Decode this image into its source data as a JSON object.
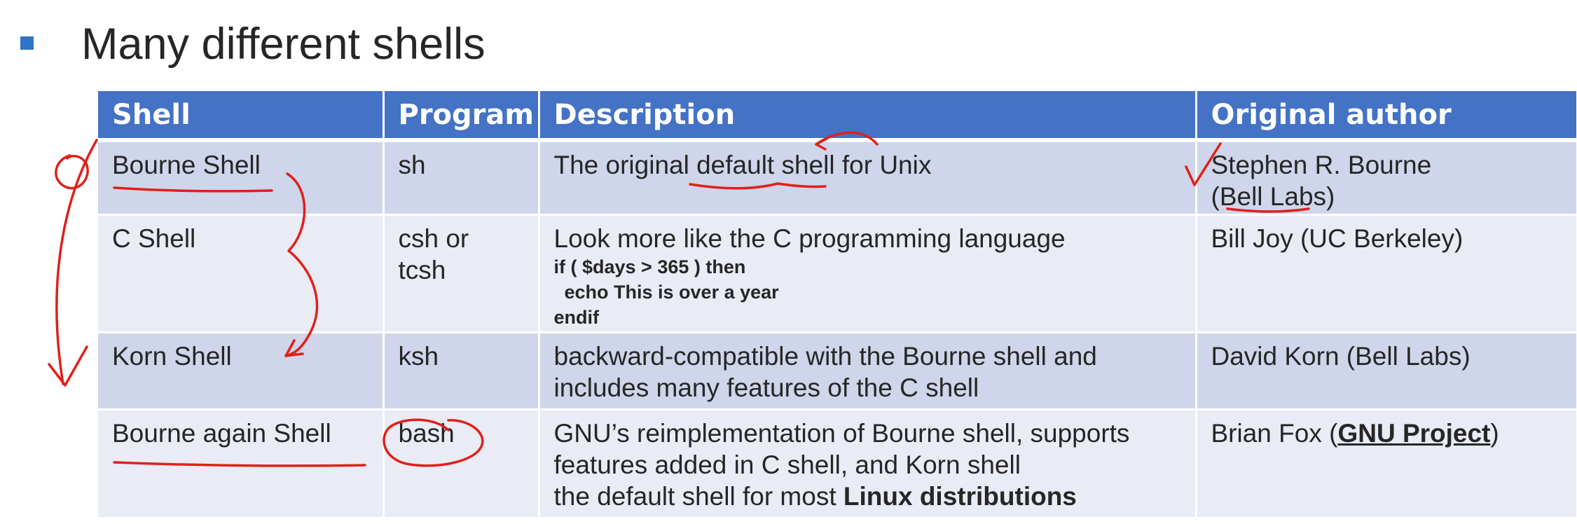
{
  "slide": {
    "title": "Many different shells"
  },
  "table": {
    "headers": [
      "Shell",
      "Program",
      "Description",
      "Original author"
    ],
    "rows": [
      {
        "shell": "Bourne Shell",
        "program": "sh",
        "description": "The original default shell for Unix",
        "author_line1": "Stephen R. Bourne",
        "author_line2": "(Bell Labs)"
      },
      {
        "shell": "C Shell",
        "program_line1": "csh or",
        "program_line2": "tcsh",
        "description": "Look more like the C programming language",
        "code_line1": "if ( $days > 365 ) then",
        "code_line2": "  echo This is over a year",
        "code_line3": "endif",
        "author": "Bill Joy (UC Berkeley)"
      },
      {
        "shell": "Korn Shell",
        "program": "ksh",
        "description_line1": "backward-compatible with the Bourne shell and",
        "description_line2": "includes many features of the C shell",
        "author": "David Korn (Bell Labs)"
      },
      {
        "shell": "Bourne again Shell",
        "program": "bash",
        "description_line1": "GNU’s reimplementation of Bourne shell, supports",
        "description_line2": "features added in C shell, and Korn shell",
        "description_line3_prefix": "the default shell for most ",
        "description_line3_bold": "Linux distributions",
        "author_prefix": "Brian Fox (",
        "author_link": "GNU Project",
        "author_suffix": ")"
      }
    ]
  },
  "colors": {
    "header_bg": "#4472c4",
    "row_odd_bg": "#cfd5ea",
    "row_even_bg": "#e9ebf5",
    "bullet": "#2e75c7",
    "annotation_ink": "#e0201a"
  }
}
